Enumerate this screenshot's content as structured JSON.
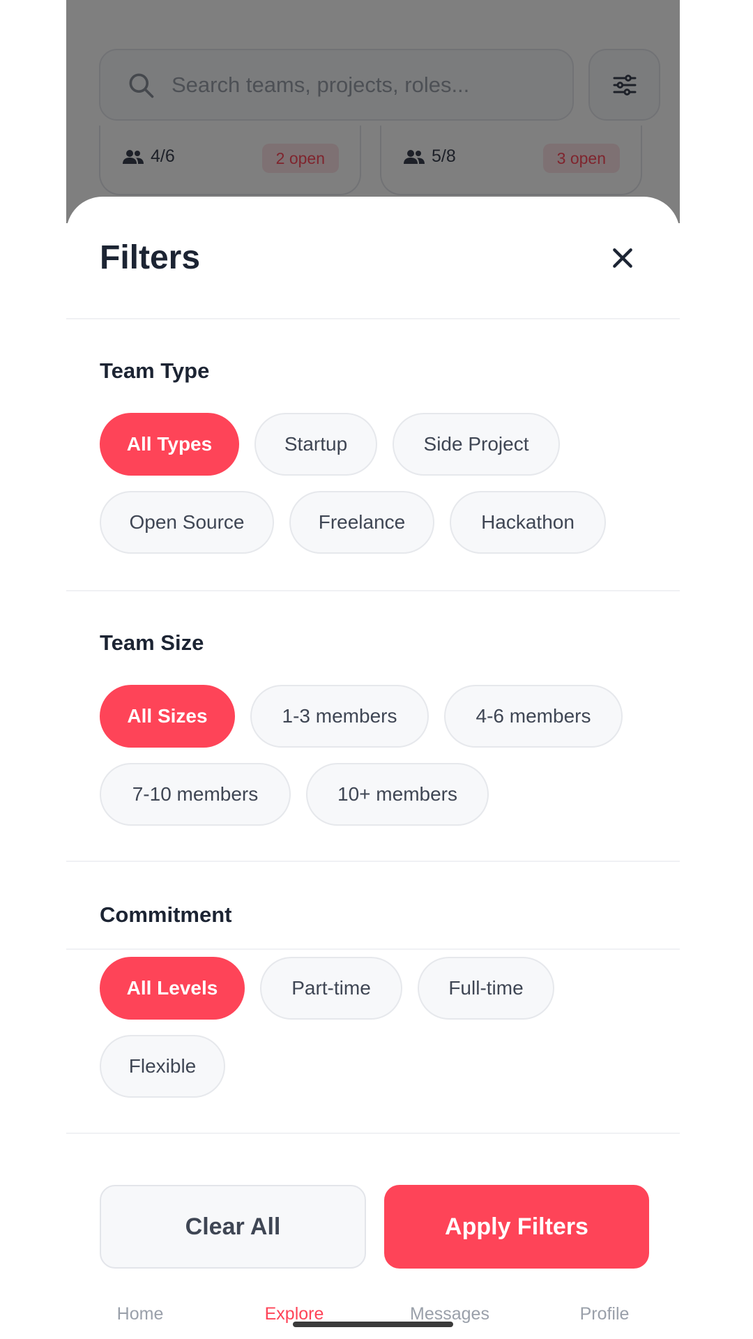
{
  "search": {
    "placeholder": "Search teams, projects, roles..."
  },
  "cards": [
    {
      "members": "4/6",
      "open": "2 open"
    },
    {
      "members": "5/8",
      "open": "3 open"
    }
  ],
  "sheet": {
    "title": "Filters",
    "sections": [
      {
        "title": "Team Type",
        "chips": [
          "All Types",
          "Startup",
          "Side Project",
          "Open Source",
          "Freelance",
          "Hackathon"
        ],
        "selected": "All Types"
      },
      {
        "title": "Team Size",
        "chips": [
          "All Sizes",
          "1-3 members",
          "4-6 members",
          "7-10 members",
          "10+ members"
        ],
        "selected": "All Sizes"
      },
      {
        "title": "Commitment",
        "chips": [
          "All Levels",
          "Part-time",
          "Full-time",
          "Flexible"
        ],
        "selected": "All Levels"
      }
    ],
    "clear_label": "Clear All",
    "apply_label": "Apply Filters"
  },
  "nav": {
    "items": [
      "Home",
      "Explore",
      "Messages",
      "Profile"
    ],
    "active": "Explore"
  },
  "colors": {
    "accent": "#fe4458",
    "title": "#1c2433",
    "chip_bg": "#f7f8fa",
    "muted": "#9aa0aa"
  }
}
